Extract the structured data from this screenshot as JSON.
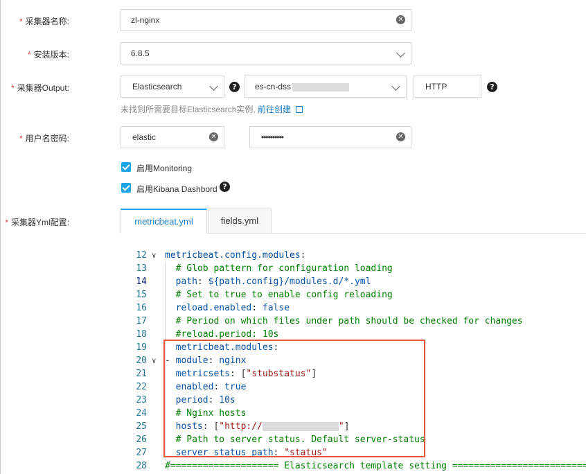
{
  "form": {
    "collector_name_label": "采集器名称:",
    "collector_name_value": "zl-nginx",
    "version_label": "安装版本:",
    "version_value": "6.8.5",
    "output_label": "采集器Output:",
    "output_type": "Elasticsearch",
    "output_instance": "es-cn-dss",
    "output_protocol": "HTTP",
    "hint_text": "未找到所需要目标Elasticsearch实例,",
    "hint_link": "前往创建",
    "credentials_label": "用户名密码:",
    "username": "elastic",
    "password": "••••••••••",
    "monitoring_label": "启用Monitoring",
    "kibana_label": "启用Kibana Dashbord",
    "yml_label": "采集器Yml配置:"
  },
  "tabs": [
    "metricbeat.yml",
    "fields.yml"
  ],
  "editor": {
    "lines": [
      {
        "n": "12",
        "fold": "v",
        "parts": [
          [
            "k",
            "metricbeat.config.modules"
          ],
          [
            "p",
            ":"
          ]
        ]
      },
      {
        "n": "13",
        "parts": [
          [
            "p",
            "  "
          ],
          [
            "c",
            "# Glob pattern for configuration loading"
          ]
        ]
      },
      {
        "n": "14",
        "parts": [
          [
            "p",
            "  "
          ],
          [
            "k",
            "path"
          ],
          [
            "p",
            ": "
          ],
          [
            "s",
            "${path.config}/modules.d/*.yml"
          ]
        ]
      },
      {
        "n": "15",
        "parts": [
          [
            "p",
            "  "
          ],
          [
            "c",
            "# Set to true to enable config reloading"
          ]
        ]
      },
      {
        "n": "16",
        "parts": [
          [
            "p",
            "  "
          ],
          [
            "k",
            "reload.enabled"
          ],
          [
            "p",
            ": "
          ],
          [
            "s",
            "false"
          ]
        ]
      },
      {
        "n": "17",
        "parts": [
          [
            "p",
            "  "
          ],
          [
            "c",
            "# Period on which files under path should be checked for changes"
          ]
        ]
      },
      {
        "n": "18",
        "parts": [
          [
            "p",
            "  "
          ],
          [
            "c",
            "#reload.period: 10s"
          ]
        ]
      },
      {
        "n": "19",
        "parts": [
          [
            "p",
            "  "
          ],
          [
            "k",
            "metricbeat.modules"
          ],
          [
            "p",
            ":"
          ]
        ]
      },
      {
        "n": "20",
        "fold": "v",
        "parts": [
          [
            "p",
            "- "
          ],
          [
            "k",
            "module"
          ],
          [
            "p",
            ": "
          ],
          [
            "s",
            "nginx"
          ]
        ]
      },
      {
        "n": "21",
        "parts": [
          [
            "p",
            "  "
          ],
          [
            "k",
            "metricsets"
          ],
          [
            "p",
            ": ["
          ],
          [
            "v",
            "\"stubstatus\""
          ],
          [
            "p",
            "]"
          ]
        ]
      },
      {
        "n": "22",
        "parts": [
          [
            "p",
            "  "
          ],
          [
            "k",
            "enabled"
          ],
          [
            "p",
            ": "
          ],
          [
            "s",
            "true"
          ]
        ]
      },
      {
        "n": "23",
        "parts": [
          [
            "p",
            "  "
          ],
          [
            "k",
            "period"
          ],
          [
            "p",
            ": "
          ],
          [
            "s",
            "10s"
          ]
        ]
      },
      {
        "n": "24",
        "parts": [
          [
            "p",
            "  "
          ],
          [
            "c",
            "# Nginx hosts"
          ]
        ]
      },
      {
        "n": "25",
        "parts": [
          [
            "p",
            "  "
          ],
          [
            "k",
            "hosts"
          ],
          [
            "p",
            ": ["
          ],
          [
            "v",
            "\"http://"
          ],
          [
            "blur",
            ""
          ],
          [
            "v",
            "\""
          ],
          [
            "p",
            "]"
          ]
        ]
      },
      {
        "n": "26",
        "parts": [
          [
            "p",
            "  "
          ],
          [
            "c",
            "# Path to server status. Default server-status"
          ]
        ]
      },
      {
        "n": "27",
        "parts": [
          [
            "p",
            "  "
          ],
          [
            "k",
            "server_status_path"
          ],
          [
            "p",
            ": "
          ],
          [
            "v",
            "\"status\""
          ]
        ]
      },
      {
        "n": "28",
        "parts": [
          [
            "c",
            "#==================== Elasticsearch template setting =========================="
          ]
        ]
      }
    ]
  },
  "colors": {
    "accent": "#1aa3e5",
    "required": "#e4393c",
    "highlight": "#e8553e"
  }
}
